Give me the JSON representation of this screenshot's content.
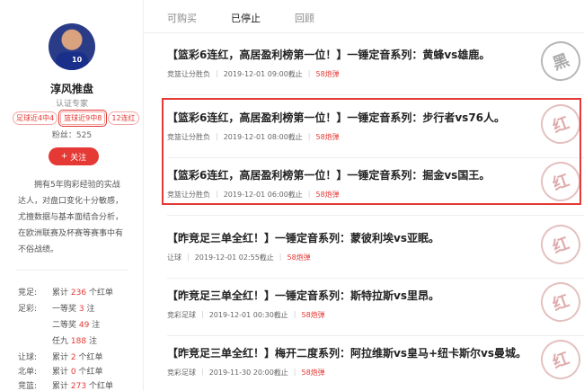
{
  "profile": {
    "avatar_number": "10",
    "name": "淳风推盘",
    "certification": "认证专家",
    "tags": [
      "足球近4中4",
      "篮球近9中8",
      "12连红"
    ],
    "fans_label": "粉丝：",
    "fans_count": "525",
    "follow_button": "关注",
    "bio": "拥有5年购彩经验的实战达人，对盘口变化十分敏感，尤擅数据与基本面结合分析，在欧洲联赛及杯赛等赛事中有不俗战绩。"
  },
  "stats": [
    {
      "cat": "竞足:",
      "prefix": "累计",
      "num": "236",
      "suffix": "个红单"
    },
    {
      "cat": "足彩:",
      "prefix": "一等奖",
      "num": "3",
      "suffix": "注"
    },
    {
      "cat": "",
      "prefix": "二等奖",
      "num": "49",
      "suffix": "注"
    },
    {
      "cat": "",
      "prefix": "任九",
      "num": "188",
      "suffix": "注"
    },
    {
      "cat": "让球:",
      "prefix": "累计",
      "num": "2",
      "suffix": "个红单"
    },
    {
      "cat": "北单:",
      "prefix": "累计",
      "num": "0",
      "suffix": "个红单"
    },
    {
      "cat": "竞篮:",
      "prefix": "累计",
      "num": "273",
      "suffix": "个红单"
    }
  ],
  "tabs": [
    "可购买",
    "已停止",
    "回顾"
  ],
  "active_tab": "已停止",
  "cards": [
    {
      "title": "【篮彩6连红，高居盈利榜第一位！】一锤定音系列：黄蜂vs雄鹿。",
      "type": "竞篮让分胜负",
      "time": "2019-12-01 09:00截止",
      "count": "58炮弹",
      "stamp": "黑"
    },
    {
      "title": "【篮彩6连红，高居盈利榜第一位！】一锤定音系列：步行者vs76人。",
      "type": "竞篮让分胜负",
      "time": "2019-12-01 08:00截止",
      "count": "58炮弹",
      "stamp": "红"
    },
    {
      "title": "【篮彩6连红，高居盈利榜第一位！】一锤定音系列：掘金vs国王。",
      "type": "竞篮让分胜负",
      "time": "2019-12-01 06:00截止",
      "count": "58炮弹",
      "stamp": "红"
    },
    {
      "title": "【昨竞足三单全红！】一锤定音系列：蒙彼利埃vs亚眠。",
      "type": "让球",
      "time": "2019-12-01 02:55截止",
      "count": "58炮弹",
      "stamp": "红"
    },
    {
      "title": "【昨竞足三单全红！】一锤定音系列：斯特拉斯vs里昂。",
      "type": "竞彩足球",
      "time": "2019-12-01 00:30截止",
      "count": "58炮弹",
      "stamp": "红"
    },
    {
      "title": "【昨竞足三单全红！】梅开二度系列：阿拉维斯vs皇马+纽卡斯尔vs曼城。",
      "type": "竞彩足球",
      "time": "2019-11-30 20:00截止",
      "count": "58炮弹",
      "stamp": "红"
    }
  ]
}
